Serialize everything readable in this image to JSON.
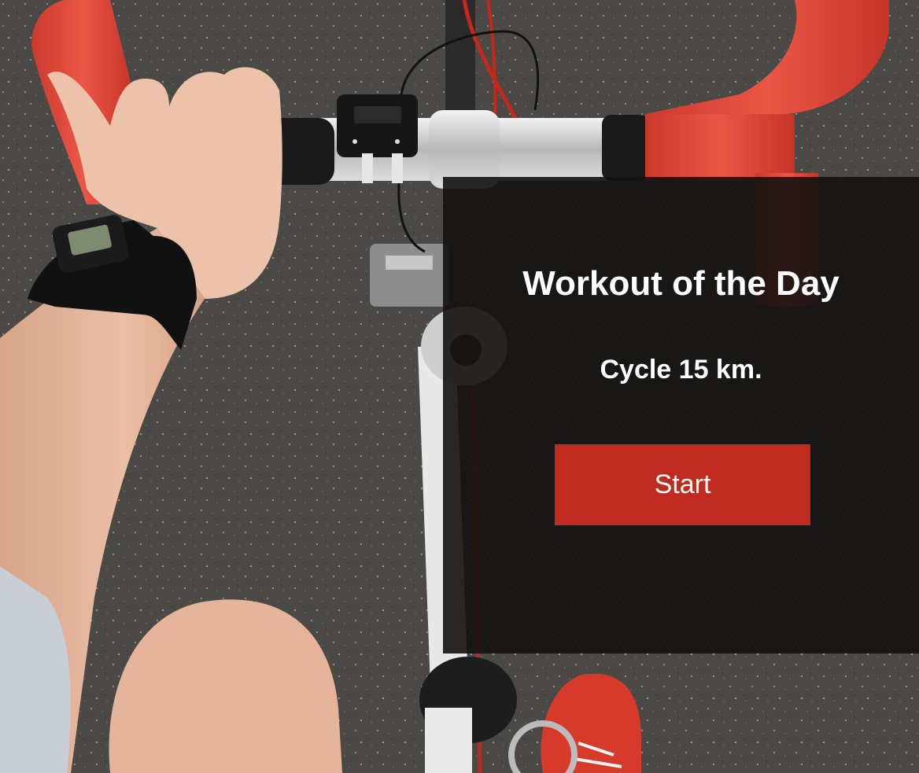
{
  "workout": {
    "title": "Workout of the Day",
    "description": "Cycle 15 km.",
    "start_label": "Start"
  },
  "colors": {
    "accent": "#bf2b1e",
    "card_background": "#141211",
    "text": "#ffffff",
    "road": "#4a4845",
    "handlebar_tape": "#e2493b",
    "shoe": "#d63a2a",
    "skin": "#e7b9a0"
  },
  "icons": {
    "bike_computer": "bike-computer-icon",
    "watch": "wristwatch-icon"
  }
}
